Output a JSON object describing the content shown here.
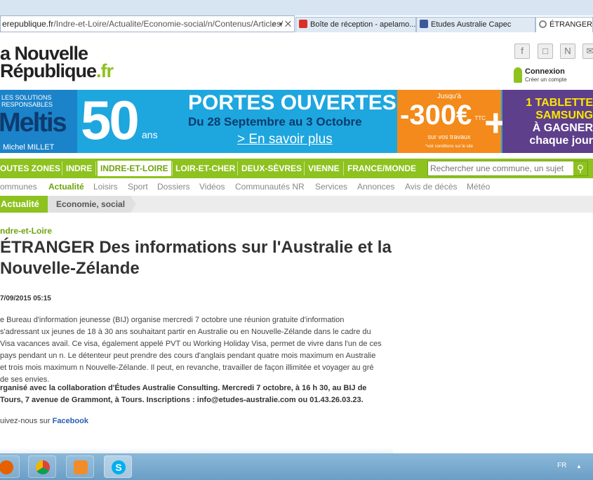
{
  "browser": {
    "address_domain": "erepublique.fr",
    "address_path": "/Indre-et-Loire/Actualite/Economie-social/n/Contenus/Articles/",
    "address_controls": "⌕ ▾ ✕",
    "tabs": [
      {
        "label": "Boîte de réception - apelamo...",
        "icon": "gmail-icon",
        "color": "#d93025"
      },
      {
        "label": "Etudes Australie Capec",
        "icon": "facebook-icon",
        "color": "#3b5998"
      },
      {
        "label": "ÉTRANGER Des",
        "icon": "loading-icon",
        "color": "#888888"
      }
    ]
  },
  "header": {
    "logo_line1": "a Nouvelle",
    "logo_line2": "République",
    "logo_suffix": ".fr",
    "social_icons": [
      "f",
      "□",
      "N",
      "✉"
    ],
    "login_label": "Connexion",
    "signup_label": "Créer un compte"
  },
  "banner": {
    "solutions": "LES SOLUTIONS RESPONSABLES",
    "brand": "Meltis",
    "by": "Michel MILLET",
    "years": "50",
    "years_label": "ans",
    "headline": "PORTES OUVERTES",
    "dates": "Du 28 Septembre au 3 Octobre",
    "cta": "> En savoir plus",
    "offer_prefix": "Jusqu'à",
    "offer_value": "-300€",
    "offer_ttc": "TTC",
    "offer_sub": "sur vos travaux",
    "offer_conditions": "*voir conditions sur le site",
    "plus": "+",
    "right_line1": "1 TABLETTE",
    "right_line2": "SAMSUNG",
    "right_line3": "À GAGNER",
    "right_line4": "chaque jour"
  },
  "nav": {
    "items": [
      "OUTES ZONES",
      "INDRE",
      "INDRE-ET-LOIRE",
      "LOIR-ET-CHER",
      "DEUX-SÈVRES",
      "VIENNE",
      "FRANCE/MONDE"
    ],
    "active_index": 2,
    "search_placeholder": "Rechercher une commune, un sujet"
  },
  "subnav": {
    "items": [
      "ommunes",
      "Actualité",
      "Loisirs",
      "Sport",
      "Dossiers",
      "Vidéos",
      "Communautés NR",
      "Services",
      "Annonces",
      "Avis de décès",
      "Météo"
    ],
    "active_index": 1
  },
  "breadcrumb": {
    "section": "Actualité",
    "subsection": "Economie, social"
  },
  "article": {
    "category": "ndre-et-Loire",
    "title": "ÉTRANGER Des informations sur l'Australie et la Nouvelle-Zélande",
    "date": "7/09/2015 05:15",
    "body": "e Bureau d'information jeunesse (BIJ) organise mercredi 7 octobre une réunion gratuite d'information s'adressant ux jeunes de 18 à 30 ans souhaitant partir en Australie ou en Nouvelle-Zélande dans le cadre du Visa vacances avail. Ce visa, également appelé PVT ou Working Holiday Visa, permet de vivre dans l'un de ces pays pendant un n. Le détenteur peut prendre des cours d'anglais pendant quatre mois maximum en Australie et trois mois maximum n Nouvelle-Zélande. Il peut, en revanche, travailler de façon illimitée et voyager au gré de ses envies.",
    "bold_paragraph": "rganisé avec la collaboration d'Études Australie Consulting. Mercredi 7 octobre, à 16 h 30, au BIJ de Tours, 7 avenue de Grammont, à Tours. Inscriptions : info@etudes-australie.com ou 01.43.26.03.23.",
    "follow_prefix": "uivez-nous sur ",
    "follow_link": "Facebook"
  },
  "taskbar": {
    "apps": [
      "firefox-icon",
      "chrome-icon",
      "media-player-icon",
      "skype-icon"
    ],
    "active_index": 3,
    "language": "FR",
    "tray_arrow": "▲"
  },
  "colors": {
    "brand_green": "#8dc21f",
    "banner_blue": "#1ea6df",
    "offer_orange": "#f38a1b",
    "offer_purple": "#5e3f8b",
    "link_blue": "#2a5db0"
  }
}
